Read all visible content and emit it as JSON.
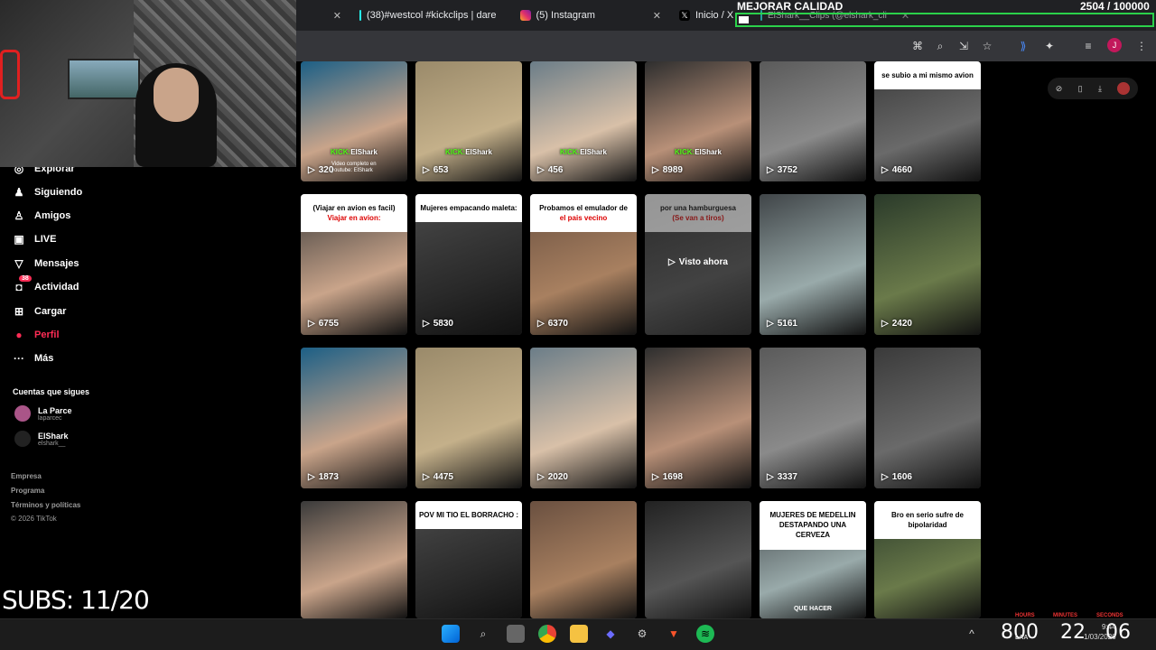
{
  "browser": {
    "tabs": [
      {
        "label": "",
        "close": "✕"
      },
      {
        "label": "(38)#westcol #kickclips | dare",
        "close": "✕",
        "color": "#25f4ee"
      },
      {
        "label": "(5) Instagram",
        "close": "✕",
        "color": "#e1306c"
      },
      {
        "label": "Inicio / X",
        "close": "",
        "color": "#ffffff"
      },
      {
        "label": "ElShark__Clips (@elshark_cli",
        "close": "✕",
        "color": "#25f4ee"
      }
    ],
    "profile_initial": "J"
  },
  "stream_overlay": {
    "goal_title": "MEJORAR CALIDAD",
    "goal_count": "2504 / 100000",
    "goal_progress": 0.025,
    "subs": "SUBS: 11/20",
    "timer_labels": [
      "HOURS",
      "MINUTES",
      "SECONDS"
    ],
    "timer_values": [
      "800",
      "22",
      "06"
    ]
  },
  "sidebar": {
    "nav": [
      {
        "label": "Explorar",
        "icon": "compass-icon",
        "glyph": "◎"
      },
      {
        "label": "Siguiendo",
        "icon": "following-icon",
        "glyph": "♟"
      },
      {
        "label": "Amigos",
        "icon": "friends-icon",
        "glyph": "♙"
      },
      {
        "label": "LIVE",
        "icon": "live-icon",
        "glyph": "▣"
      },
      {
        "label": "Mensajes",
        "icon": "messages-icon",
        "glyph": "▽"
      },
      {
        "label": "Actividad",
        "icon": "activity-icon",
        "glyph": "◘",
        "badge": "38"
      },
      {
        "label": "Cargar",
        "icon": "upload-icon",
        "glyph": "⊞"
      },
      {
        "label": "Perfil",
        "icon": "profile-icon",
        "glyph": "●",
        "active": true
      },
      {
        "label": "Más",
        "icon": "more-icon",
        "glyph": "···"
      }
    ],
    "following_title": "Cuentas que sigues",
    "following": [
      {
        "name": "La Parce",
        "handle": "laparcec"
      },
      {
        "name": "ElShark",
        "handle": "elshark__"
      }
    ],
    "footer": [
      "Empresa",
      "Programa",
      "Términos y políticas",
      "© 2026 TikTok"
    ]
  },
  "grid": {
    "row1": [
      {
        "views": "320",
        "kick": "ElShark",
        "overlay": "Video completo en youtube: ElShark"
      },
      {
        "views": "653",
        "kick": "ElShark"
      },
      {
        "views": "456",
        "kick": "ElShark"
      },
      {
        "views": "8989",
        "kick": "ElShark"
      },
      {
        "views": "3752"
      },
      {
        "views": "4660",
        "caption": "se subio a mi mismo avion"
      }
    ],
    "row2": [
      {
        "views": "6755",
        "caption": "(Viajar en avion es facil)",
        "caption_red": "Viajar en avion:"
      },
      {
        "views": "5830",
        "caption": "Mujeres empacando maleta:"
      },
      {
        "views": "6370",
        "caption": "Probamos el emulador de",
        "caption_red": "el pais vecino"
      },
      {
        "views": "",
        "caption": "por una hamburguesa",
        "caption_red": "(Se van a tiros)",
        "watched": "Visto ahora"
      },
      {
        "views": "5161"
      },
      {
        "views": "2420"
      }
    ],
    "row3": [
      {
        "views": "1873"
      },
      {
        "views": "4475"
      },
      {
        "views": "2020"
      },
      {
        "views": "1698"
      },
      {
        "views": "3337"
      },
      {
        "views": "1606"
      }
    ],
    "row4": [
      {
        "views": ""
      },
      {
        "views": "",
        "caption": "POV MI TIO EL BORRACHO :"
      },
      {
        "views": ""
      },
      {
        "views": ""
      },
      {
        "views": "",
        "caption": "MUJERES DE MEDELLIN DESTAPANDO UNA CERVEZA",
        "bottom": "QUE HACER"
      },
      {
        "views": "",
        "caption": "Bro en serio sufre de bipolaridad"
      }
    ],
    "play_glyph": "▷",
    "kick_prefix": "KICK:"
  },
  "system": {
    "time": "9:44",
    "date": "1/03/2026",
    "lang": "LAA"
  }
}
